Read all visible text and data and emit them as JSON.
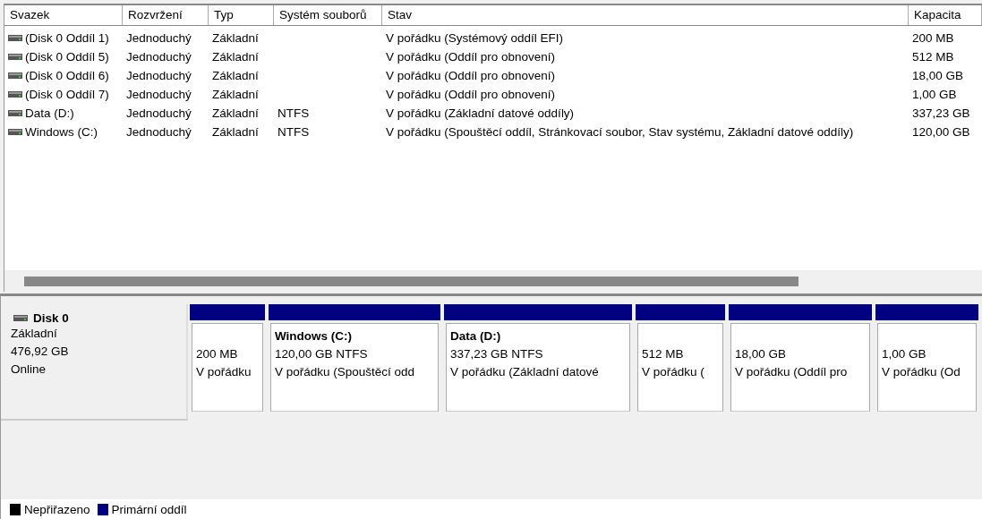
{
  "volume_list": {
    "columns": [
      "Svazek",
      "Rozvržení",
      "Typ",
      "Systém souborů",
      "Stav",
      "Kapacita"
    ],
    "rows": [
      {
        "cells": [
          "(Disk 0 Oddíl 1)",
          "Jednoduchý",
          "Základní",
          "",
          "V pořádku (Systémový oddíl EFI)",
          "200 MB"
        ]
      },
      {
        "cells": [
          "(Disk 0 Oddíl 5)",
          "Jednoduchý",
          "Základní",
          "",
          "V pořádku (Oddíl pro obnovení)",
          "512 MB"
        ]
      },
      {
        "cells": [
          "(Disk 0 Oddíl 6)",
          "Jednoduchý",
          "Základní",
          "",
          "V pořádku (Oddíl pro obnovení)",
          "18,00 GB"
        ]
      },
      {
        "cells": [
          "(Disk 0 Oddíl 7)",
          "Jednoduchý",
          "Základní",
          "",
          "V pořádku (Oddíl pro obnovení)",
          "1,00 GB"
        ]
      },
      {
        "cells": [
          "Data (D:)",
          "Jednoduchý",
          "Základní",
          "NTFS",
          "V pořádku (Základní datové oddíly)",
          "337,23 GB"
        ]
      },
      {
        "cells": [
          "Windows (C:)",
          "Jednoduchý",
          "Základní",
          "NTFS",
          "V pořádku (Spouštěcí oddíl, Stránkovací soubor, Stav systému, Základní datové oddíly)",
          "120,00 GB"
        ]
      }
    ]
  },
  "disk": {
    "name": "Disk 0",
    "type": "Základní",
    "size": "476,92 GB",
    "status": "Online",
    "partitions": [
      {
        "kind": "primary",
        "size": "200 MB",
        "status": "V pořádku"
      },
      {
        "kind": "primary",
        "name": "Windows  (C:)",
        "size": "120,00 GB NTFS",
        "status": "V pořádku (Spouštěcí odd"
      },
      {
        "kind": "primary",
        "name": "Data  (D:)",
        "size": "337,23 GB NTFS",
        "status": "V pořádku (Základní datové"
      },
      {
        "kind": "primary",
        "size": "512 MB",
        "status": "V pořádku ("
      },
      {
        "kind": "primary",
        "size": "18,00 GB",
        "status": "V pořádku (Oddíl pro"
      },
      {
        "kind": "primary",
        "size": "1,00 GB",
        "status": "V pořádku (Od"
      }
    ]
  },
  "legend": [
    {
      "label": "Nepřiřazeno",
      "color": "#000000"
    },
    {
      "label": "Primární oddíl",
      "color": "#000080"
    }
  ]
}
